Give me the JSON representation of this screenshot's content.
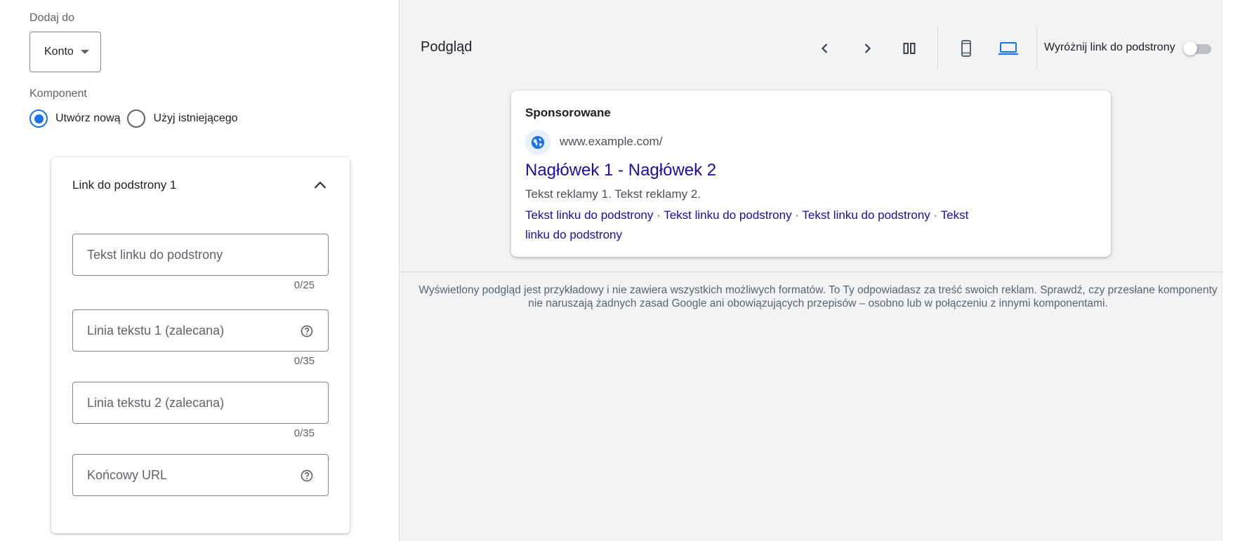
{
  "form": {
    "add_to_label": "Dodaj do",
    "add_to_value": "Konto",
    "component_label": "Komponent",
    "radio_create_new": "Utwórz nową",
    "radio_use_existing": "Użyj istniejącego",
    "radio_selected": "create_new"
  },
  "sitelink_card": {
    "title": "Link do podstrony 1",
    "fields": [
      {
        "placeholder": "Tekst linku do podstrony",
        "counter": "0/25"
      },
      {
        "placeholder": "Linia tekstu 1 (zalecana)",
        "counter": "0/35",
        "help_icon": "help-circle-icon"
      },
      {
        "placeholder": "Linia tekstu 2 (zalecana)",
        "counter": "0/35"
      },
      {
        "placeholder": "Końcowy URL",
        "help_icon": "help-circle-icon"
      }
    ]
  },
  "preview": {
    "title": "Podgląd",
    "toolbar_icons": [
      "chevron-left-icon",
      "chevron-right-icon",
      "view-column-icon",
      "smartphone-icon",
      "laptop-icon"
    ],
    "active_device": "laptop",
    "highlight_label": "Wyróżnij link do podstrony",
    "highlight_enabled": false,
    "ad": {
      "sponsored_label": "Sponsorowane",
      "display_url": "www.example.com/",
      "headline": "Nagłówek 1 - Nagłówek 2",
      "description": "Tekst reklamy 1. Tekst reklamy 2.",
      "sitelinks": [
        "Tekst linku do podstrony",
        "Tekst linku do podstrony",
        "Tekst linku do podstrony",
        "Tekst linku do podstrony"
      ]
    },
    "disclaimer": "Wyświetlony podgląd jest przykładowy i nie zawiera wszystkich możliwych formatów. To Ty odpowiadasz za treść swoich reklam. Sprawdź, czy przesłane komponenty nie naruszają żadnych zasad Google ani obowiązujących przepisów – osobno lub w połączeniu z innymi komponentami."
  },
  "colors": {
    "accent": "#1a73e8",
    "link": "#1a0dab",
    "panel_bg": "#f1f3f4"
  }
}
